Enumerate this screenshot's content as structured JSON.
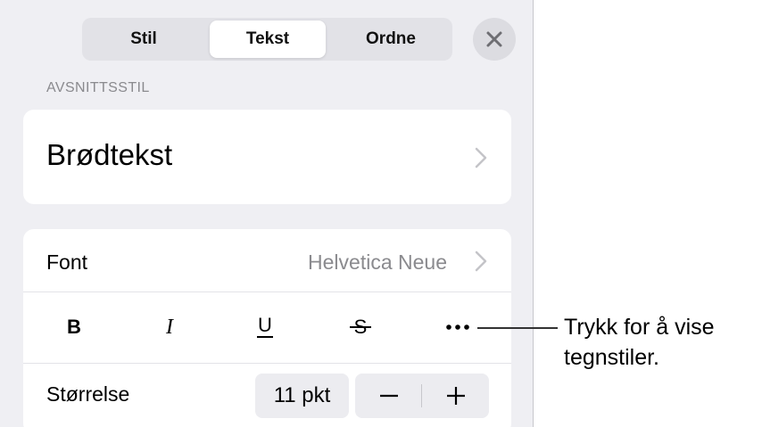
{
  "tabs": [
    {
      "label": "Stil"
    },
    {
      "label": "Tekst",
      "active": true
    },
    {
      "label": "Ordne"
    }
  ],
  "paragraph_style": {
    "section_label": "AVSNITTSSTIL",
    "value": "Brødtekst"
  },
  "font_row": {
    "label": "Font",
    "value": "Helvetica Neue"
  },
  "format_buttons": [
    {
      "name": "bold",
      "icon": "bold-icon"
    },
    {
      "name": "italic",
      "icon": "italic-icon"
    },
    {
      "name": "underline",
      "icon": "underline-icon"
    },
    {
      "name": "strikethrough",
      "icon": "strikethrough-icon"
    },
    {
      "name": "more",
      "icon": "more-icon"
    }
  ],
  "size_row": {
    "label": "Størrelse",
    "value": "11 pkt"
  },
  "callout": {
    "text": "Trykk for å vise tegnstiler."
  },
  "colors": {
    "panel_bg": "#efeff3",
    "card_bg": "#ffffff",
    "secondary_text": "#8a8a8e"
  }
}
